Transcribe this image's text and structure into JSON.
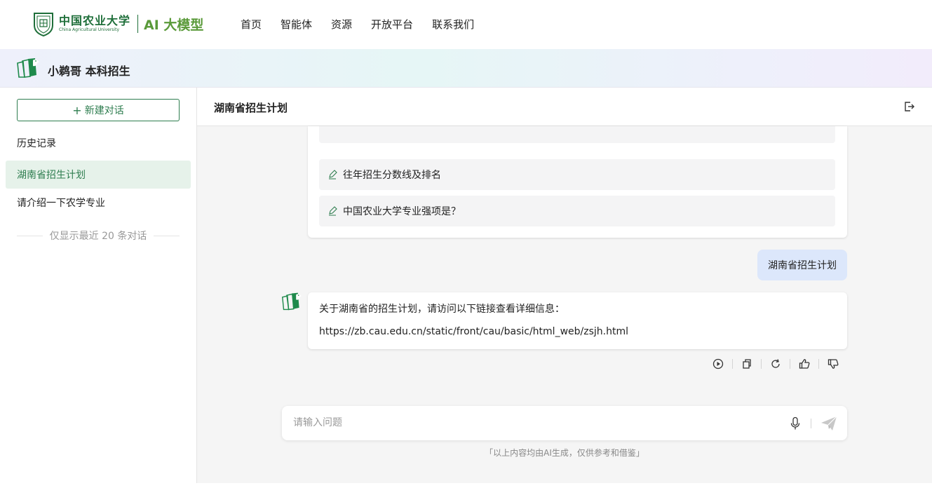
{
  "brand": {
    "school_cn": "中国农业大学",
    "school_en": "China Agricultural University",
    "product": "AI 大模型"
  },
  "nav": {
    "items": [
      "首页",
      "智能体",
      "资源",
      "开放平台",
      "联系我们"
    ]
  },
  "agent": {
    "name": "小鹈哥 本科招生"
  },
  "sidebar": {
    "new_chat_label": "新建对话",
    "history_title": "历史记录",
    "history_items": [
      "湖南省招生计划",
      "请介绍一下农学专业"
    ],
    "active_index": 0,
    "history_note": "仅显示最近 20 条对话"
  },
  "conversation": {
    "title": "湖南省招生计划",
    "suggestions": [
      "往年招生分数线及排名",
      "中国农业大学专业强项是？"
    ],
    "user_message": "湖南省招生计划",
    "bot_reply_line1": "关于湖南省的招生计划，请访问以下链接查看详细信息：",
    "bot_reply_link": "https://zb.cau.edu.cn/static/front/cau/basic/html_web/zsjh.html",
    "actions": [
      "play-icon",
      "copy-icon",
      "refresh-icon",
      "thumbs-up-icon",
      "thumbs-down-icon"
    ]
  },
  "composer": {
    "placeholder": "请输入问题",
    "disclaimer": "「以上内容均由AI生成，仅供参考和借鉴」"
  },
  "colors": {
    "brand_green": "#2e7d4f",
    "active_bg": "#e6f2ea",
    "user_bubble": "#dce7fb"
  }
}
